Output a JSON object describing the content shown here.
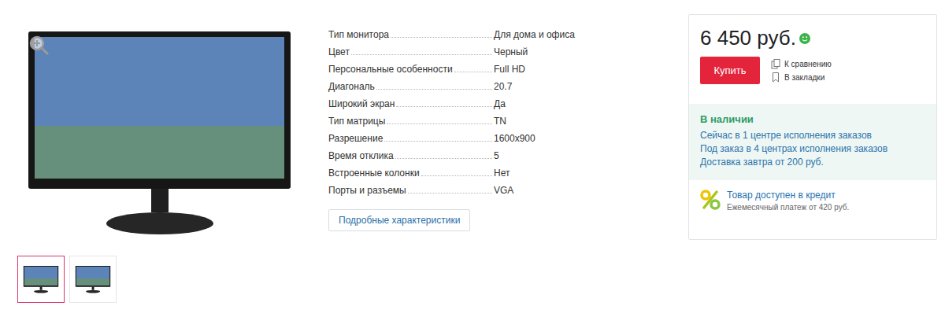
{
  "gallery": {
    "thumbnails": [
      {
        "selected": true
      },
      {
        "selected": false
      }
    ]
  },
  "specs": [
    {
      "label": "Тип монитора",
      "value": "Для дома и офиса"
    },
    {
      "label": "Цвет",
      "value": "Черный"
    },
    {
      "label": "Персональные особенности",
      "value": "Full HD"
    },
    {
      "label": "Диагональ",
      "value": "20.7"
    },
    {
      "label": "Широкий экран",
      "value": "Да"
    },
    {
      "label": "Тип матрицы",
      "value": "TN"
    },
    {
      "label": "Разрешение",
      "value": "1600x900"
    },
    {
      "label": "Время отклика",
      "value": "5"
    },
    {
      "label": "Встроенные колонки",
      "value": "Нет"
    },
    {
      "label": "Порты и разъемы",
      "value": "VGA"
    }
  ],
  "details_button": "Подробные характеристики",
  "offer": {
    "price": "6 450 руб.",
    "buy_button": "Купить",
    "actions": [
      "К сравнению",
      "В закладки"
    ],
    "availability": {
      "title": "В наличии",
      "lines": [
        "Сейчас в 1 центре исполнения заказов",
        "Под заказ в 4 центрах исполнения заказов",
        "Доставка завтра от 200 руб."
      ]
    },
    "credit": {
      "title": "Товар доступен в кредит",
      "note": "Ежемесячный платеж от 420 руб."
    }
  }
}
